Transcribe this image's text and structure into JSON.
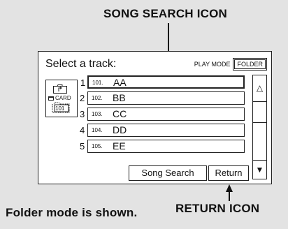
{
  "callouts": {
    "song_search": "SONG SEARCH ICON",
    "return": "RETURN ICON",
    "caption": "Folder mode is shown."
  },
  "screen": {
    "title": "Select a track:",
    "play_mode_label": "PLAY MODE",
    "play_mode_value": "FOLDER",
    "card_label": "CARD",
    "folder_number": "101",
    "tracks": [
      {
        "num": "1",
        "index": "101.",
        "name": "AA",
        "selected": true
      },
      {
        "num": "2",
        "index": "102.",
        "name": "BB"
      },
      {
        "num": "3",
        "index": "103.",
        "name": "CC"
      },
      {
        "num": "4",
        "index": "104.",
        "name": "DD"
      },
      {
        "num": "5",
        "index": "105.",
        "name": "EE"
      }
    ],
    "song_search_label": "Song Search",
    "return_label": "Return",
    "scroll_up_icon": "△",
    "scroll_down_icon": "▼"
  }
}
